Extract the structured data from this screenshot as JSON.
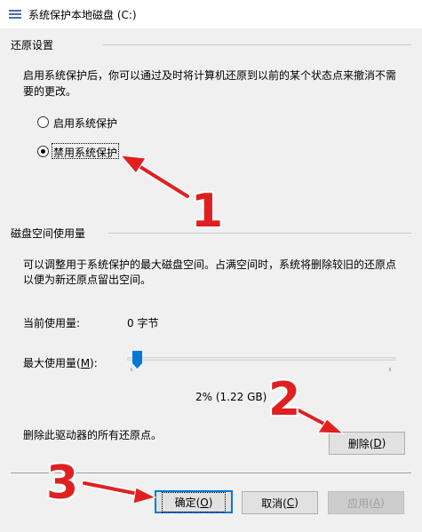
{
  "window": {
    "title": "系统保护本地磁盘 (C:)"
  },
  "restore_settings": {
    "heading": "还原设置",
    "description_line1": "启用系统保护后，你可以通过及时将计算机还原到以前的某个状态点来撤消不需",
    "description_line2": "要的更改。",
    "options": [
      {
        "label": "启用系统保护",
        "checked": false
      },
      {
        "label": "禁用系统保护",
        "checked": true
      }
    ]
  },
  "disk_usage": {
    "heading": "磁盘空间使用量",
    "description_line1": "可以调整用于系统保护的最大磁盘空间。占满空间时，系统将删除较旧的还原点",
    "description_line2": "以便为新还原点留出空间。",
    "current_label": "当前使用量:",
    "current_value": "0 字节",
    "max_label_prefix": "最大使用量(",
    "max_label_key": "M",
    "max_label_suffix": "):",
    "slider_percent": 2,
    "slider_value_text": "2% (1.22 GB)",
    "delete_text": "删除此驱动器的所有还原点。",
    "delete_button_prefix": "删除(",
    "delete_button_key": "D",
    "delete_button_suffix": ")"
  },
  "footer": {
    "ok_prefix": "确定(",
    "ok_key": "O",
    "ok_suffix": ")",
    "cancel_prefix": "取消(",
    "cancel_key": "C",
    "cancel_suffix": ")",
    "apply_prefix": "应用(",
    "apply_key": "A",
    "apply_suffix": ")"
  },
  "annotations": {
    "step1": "1",
    "step2": "2",
    "step3": "3",
    "color": "#e02020"
  },
  "colors": {
    "accent": "#0078d7",
    "slider_thumb": "#0078d7"
  }
}
